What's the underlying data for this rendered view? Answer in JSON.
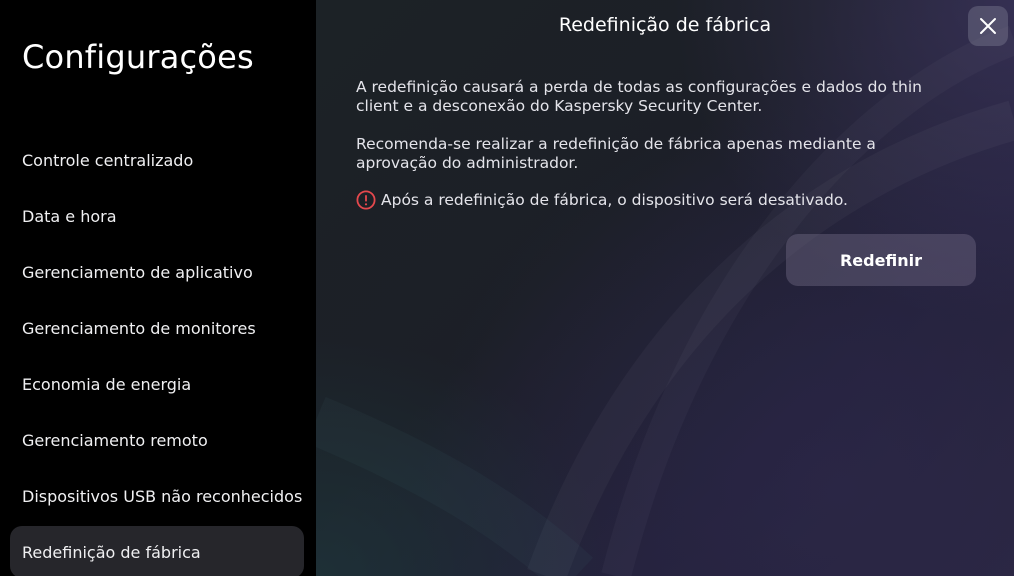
{
  "sidebar": {
    "title": "Configurações",
    "items": [
      {
        "label": "Controle centralizado",
        "active": false
      },
      {
        "label": "Data e hora",
        "active": false
      },
      {
        "label": "Gerenciamento de aplicativo",
        "active": false
      },
      {
        "label": "Gerenciamento de monitores",
        "active": false
      },
      {
        "label": "Economia de energia",
        "active": false
      },
      {
        "label": "Gerenciamento remoto",
        "active": false
      },
      {
        "label": "Dispositivos USB não reconhecidos",
        "active": false
      },
      {
        "label": "Redefinição de fábrica",
        "active": true
      }
    ]
  },
  "main": {
    "title": "Redefinição de fábrica",
    "paragraph_1": "A redefinição causará a perda de todas as configurações e dados do thin client e a desconexão do Kaspersky Security Center.",
    "paragraph_2": "Recomenda-se realizar a redefinição de fábrica apenas mediante a aprovação do administrador.",
    "warning_text": "Após a redefinição de fábrica, o dispositivo será desativado.",
    "warning_icon": "exclamation-circle-icon",
    "reset_button_label": "Redefinir",
    "close_icon": "close-icon"
  },
  "colors": {
    "warning": "#e5484d",
    "active_item_bg": "#26262b",
    "button_bg": "#5a5670"
  }
}
